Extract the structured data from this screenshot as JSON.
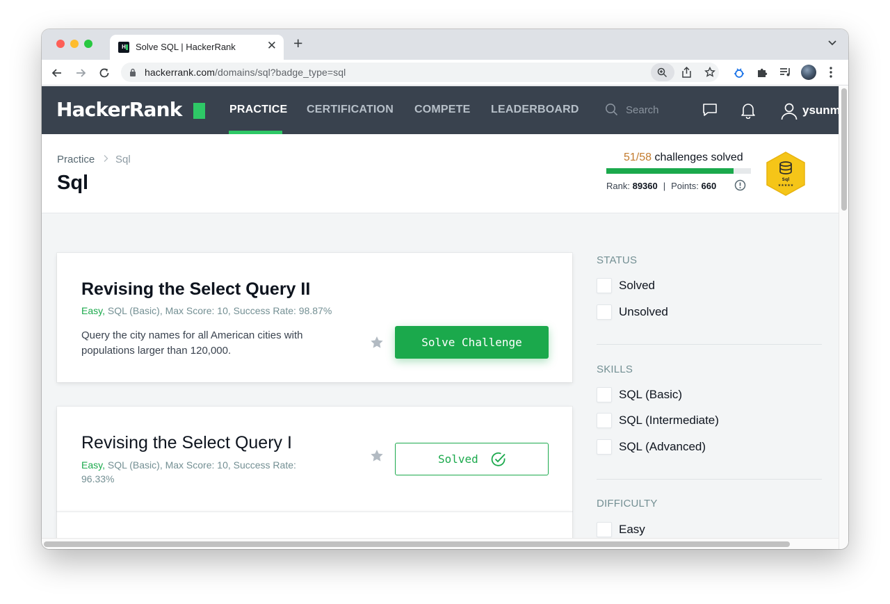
{
  "browser": {
    "tab_title": "Solve SQL | HackerRank",
    "tab_favicon_text": "H",
    "url_host": "hackerrank.com",
    "url_path": "/domains/sql?badge_type=sql"
  },
  "header": {
    "logo": "HackerRank",
    "nav": [
      "PRACTICE",
      "CERTIFICATION",
      "COMPETE",
      "LEADERBOARD"
    ],
    "active_nav": "PRACTICE",
    "search_placeholder": "Search",
    "username": "ysunm"
  },
  "page": {
    "breadcrumb": [
      "Practice",
      "Sql"
    ],
    "title": "Sql",
    "solved_count": "51/58",
    "solved_suffix": "challenges solved",
    "progress_fraction": 0.879,
    "rank_label": "Rank:",
    "rank_value": "89360",
    "rank_sep": "|",
    "points_label": "Points:",
    "points_value": "660",
    "badge_label": "Sql",
    "badge_stars": "★★★★★"
  },
  "challenges": [
    {
      "title": "Revising the Select Query II",
      "difficulty": "Easy,",
      "meta": " SQL (Basic), Max Score: 10, Success Rate: 98.87%",
      "description": "Query the city names for all American cities with populations larger than 120,000.",
      "action": "Solve Challenge"
    },
    {
      "title": "Revising the Select Query I",
      "difficulty": "Easy,",
      "meta": " SQL (Basic), Max Score: 10, Success Rate: 96.33%",
      "action": "Solved"
    }
  ],
  "filters": {
    "status": {
      "heading": "STATUS",
      "options": [
        "Solved",
        "Unsolved"
      ]
    },
    "skills": {
      "heading": "SKILLS",
      "options": [
        "SQL (Basic)",
        "SQL (Intermediate)",
        "SQL (Advanced)"
      ]
    },
    "difficulty": {
      "heading": "DIFFICULTY",
      "options": [
        "Easy"
      ]
    }
  },
  "colors": {
    "hr_green": "#1ba94c",
    "nav_bg": "#39424e",
    "progress_orange": "#c37b2d",
    "badge_gold": "#f5c518"
  }
}
